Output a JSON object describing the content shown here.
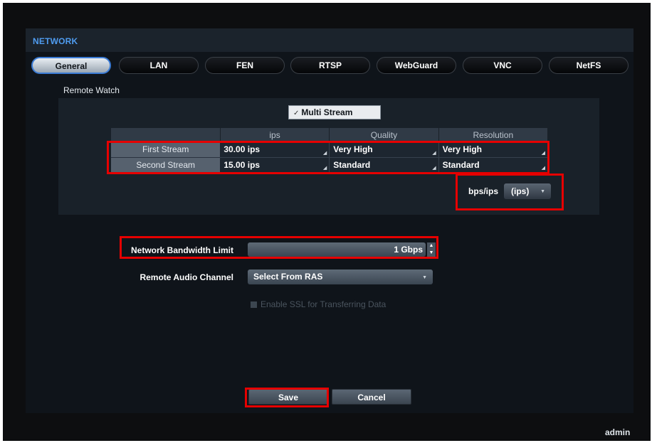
{
  "panel": {
    "title": "NETWORK"
  },
  "tabs": [
    {
      "label": "General",
      "active": true
    },
    {
      "label": "LAN"
    },
    {
      "label": "FEN"
    },
    {
      "label": "RTSP"
    },
    {
      "label": "WebGuard"
    },
    {
      "label": "VNC"
    },
    {
      "label": "NetFS"
    }
  ],
  "remote_watch": {
    "section_label": "Remote Watch",
    "multi_stream": {
      "label": "Multi Stream",
      "checked": true
    },
    "table": {
      "headers": [
        "",
        "ips",
        "Quality",
        "Resolution"
      ],
      "rows": [
        {
          "label": "First Stream",
          "ips": "30.00 ips",
          "quality": "Very High",
          "resolution": "Very High"
        },
        {
          "label": "Second Stream",
          "ips": "15.00 ips",
          "quality": "Standard",
          "resolution": "Standard"
        }
      ]
    },
    "bps_ips": {
      "label": "bps/ips",
      "value": "(ips)"
    }
  },
  "bandwidth": {
    "label": "Network Bandwidth Limit",
    "value": "1 Gbps"
  },
  "audio": {
    "label": "Remote Audio Channel",
    "value": "Select From RAS"
  },
  "ssl": {
    "label": "Enable SSL for Transferring Data",
    "enabled": false
  },
  "buttons": {
    "save": "Save",
    "cancel": "Cancel"
  },
  "status": {
    "user": "admin"
  },
  "colors": {
    "accent": "#4f9cf0",
    "highlight_box": "#e60000",
    "tab_active": "#3a7bd5"
  }
}
